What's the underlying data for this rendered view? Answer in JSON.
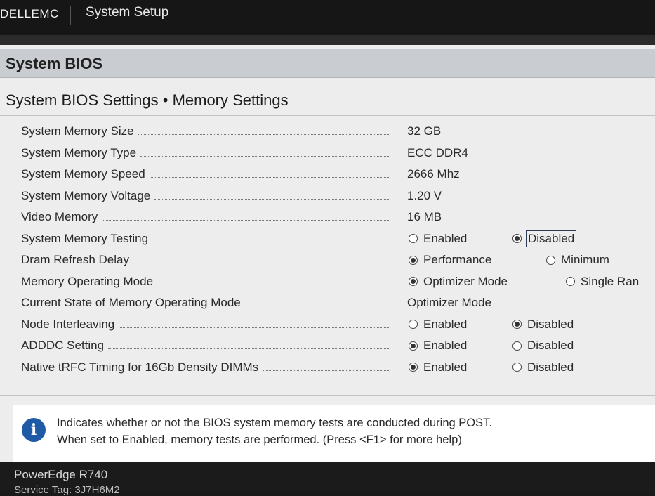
{
  "topbar": {
    "brand": "DELLEMC",
    "title": "System Setup"
  },
  "header": {
    "title": "System BIOS"
  },
  "breadcrumb": "System BIOS Settings • Memory Settings",
  "settings": [
    {
      "label": "System Memory Size",
      "value": "32 GB"
    },
    {
      "label": "System Memory Type",
      "value": "ECC DDR4"
    },
    {
      "label": "System Memory Speed",
      "value": "2666 Mhz"
    },
    {
      "label": "System Memory Voltage",
      "value": "1.20 V"
    },
    {
      "label": "Video Memory",
      "value": "16 MB"
    },
    {
      "label": "System Memory Testing",
      "options": [
        {
          "label": "Enabled",
          "selected": false
        },
        {
          "label": "Disabled",
          "selected": true
        }
      ]
    },
    {
      "label": "Dram Refresh Delay",
      "options": [
        {
          "label": "Performance",
          "selected": true
        },
        {
          "label": "Minimum",
          "selected": false
        }
      ]
    },
    {
      "label": "Memory Operating Mode",
      "options": [
        {
          "label": "Optimizer Mode",
          "selected": true
        },
        {
          "label": "Single Ran",
          "selected": false
        }
      ]
    },
    {
      "label": "Current State of Memory Operating Mode",
      "value": "Optimizer Mode"
    },
    {
      "label": "Node Interleaving",
      "options": [
        {
          "label": "Enabled",
          "selected": false
        },
        {
          "label": "Disabled",
          "selected": true
        }
      ]
    },
    {
      "label": "ADDDC Setting",
      "options": [
        {
          "label": "Enabled",
          "selected": true
        },
        {
          "label": "Disabled",
          "selected": false
        }
      ]
    },
    {
      "label": "Native tRFC Timing for 16Gb Density DIMMs",
      "options": [
        {
          "label": "Enabled",
          "selected": true
        },
        {
          "label": "Disabled",
          "selected": false
        }
      ]
    }
  ],
  "help": {
    "icon": "info-icon",
    "line1": "Indicates whether or not the BIOS system memory tests are conducted during POST.",
    "line2": "When set to Enabled, memory tests are performed. (Press <F1> for more help)"
  },
  "footer": {
    "model": "PowerEdge R740",
    "service_tag": "Service Tag: 3J7H6M2"
  }
}
